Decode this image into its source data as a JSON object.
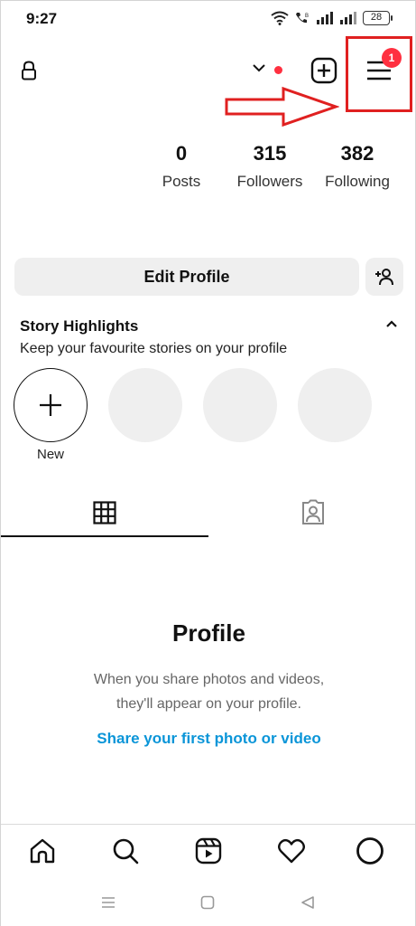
{
  "status_bar": {
    "time": "9:27",
    "battery": "28"
  },
  "top_bar": {
    "notification_count": "1"
  },
  "stats": [
    {
      "value": "0",
      "label": "Posts"
    },
    {
      "value": "315",
      "label": "Followers"
    },
    {
      "value": "382",
      "label": "Following"
    }
  ],
  "buttons": {
    "edit_profile": "Edit Profile"
  },
  "highlights": {
    "title": "Story Highlights",
    "subtitle": "Keep your favourite stories on your profile",
    "new_label": "New"
  },
  "empty_state": {
    "title": "Profile",
    "line1": "When you share photos and videos,",
    "line2": "they'll appear on your profile.",
    "link": "Share your first photo or video"
  },
  "colors": {
    "notification": "#ff3040",
    "annotation": "#e02020",
    "link": "#0a95d8",
    "button_bg": "#efefef"
  },
  "icons": {
    "top_bar": [
      "lock-icon",
      "chevron-down-icon",
      "plus-square-icon",
      "hamburger-menu-icon"
    ],
    "tabs": [
      "grid-icon",
      "tagged-person-icon"
    ],
    "bottom_nav": [
      "home-icon",
      "search-icon",
      "reels-icon",
      "heart-icon",
      "profile-avatar-icon"
    ],
    "system_nav": [
      "recents-icon",
      "home-square-icon",
      "back-triangle-icon"
    ]
  }
}
